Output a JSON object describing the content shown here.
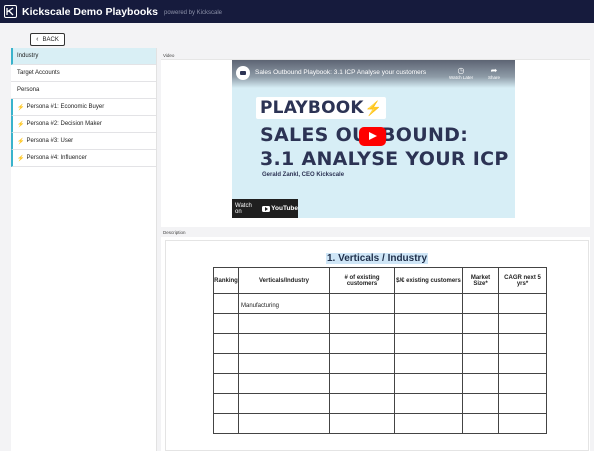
{
  "header": {
    "app_title": "Kickscale Demo Playbooks",
    "powered_by": "powered by Kickscale"
  },
  "back_button": {
    "label": "BACK"
  },
  "sidebar": {
    "items": [
      {
        "label": "Industry",
        "active": true,
        "bolt": false
      },
      {
        "label": "Target Accounts",
        "active": false,
        "bolt": false
      },
      {
        "label": "Persona",
        "active": false,
        "bolt": false
      },
      {
        "label": "Persona #1: Economic Buyer",
        "active": false,
        "bolt": true
      },
      {
        "label": "Persona #2: Decision Maker",
        "active": false,
        "bolt": true
      },
      {
        "label": "Persona #3: User",
        "active": false,
        "bolt": true
      },
      {
        "label": "Persona #4: Influencer",
        "active": false,
        "bolt": true
      }
    ]
  },
  "video_section": {
    "label": "Video",
    "video_title": "Sales Outbound Playbook: 3.1 ICP Analyse your customers",
    "watch_later": "Watch Later",
    "share": "Share",
    "thumb_playbook": "PLAYBOOK",
    "thumb_line1": "SALES OUTBOUND:",
    "thumb_line2": "3.1 ANALYSE YOUR ICP",
    "thumb_author": "Gerald Zankl, CEO Kickscale",
    "watch_on": "Watch on",
    "youtube": "YouTube"
  },
  "description_section": {
    "label": "Description",
    "doc_title": "1. Verticals / Industry",
    "table": {
      "headers": [
        "Ranking",
        "Verticals/Industry",
        "# of existing customers",
        "$/€ existing customers",
        "Market Size*",
        "CAGR next 5 yrs*"
      ],
      "rows": [
        [
          "",
          "Manufacturing",
          "",
          "",
          "",
          ""
        ],
        [
          "",
          "",
          "",
          "",
          "",
          ""
        ],
        [
          "",
          "",
          "",
          "",
          "",
          ""
        ],
        [
          "",
          "",
          "",
          "",
          "",
          ""
        ],
        [
          "",
          "",
          "",
          "",
          "",
          ""
        ],
        [
          "",
          "",
          "",
          "",
          "",
          ""
        ],
        [
          "",
          "",
          "",
          "",
          "",
          ""
        ]
      ]
    }
  },
  "colors": {
    "topbar": "#161b3d",
    "accent": "#39b3cc",
    "active_bg": "#d9eff5",
    "youtube_red": "#ff0000",
    "highlight": "#cfe6f7"
  }
}
